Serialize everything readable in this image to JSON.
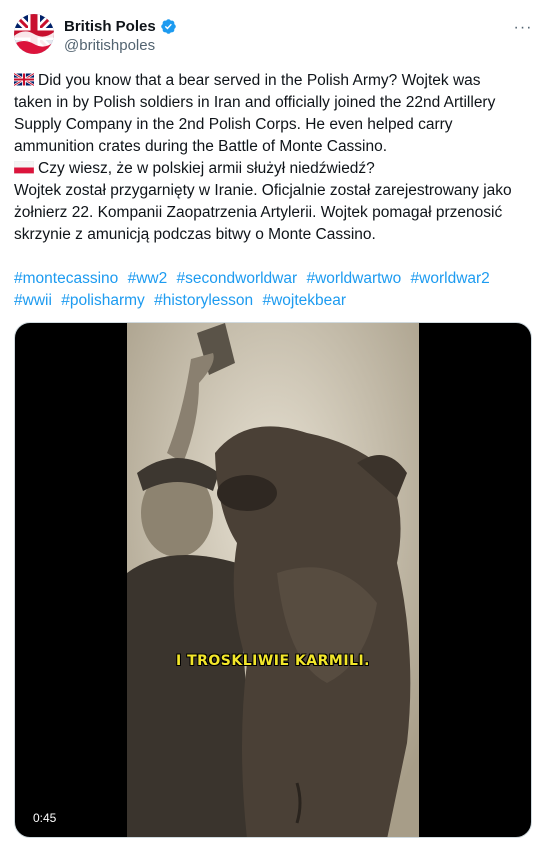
{
  "author": {
    "name": "British Poles",
    "handle": "@britishpoles"
  },
  "more_icon": "more-horizontal-icon",
  "tweet": {
    "english_lines": [
      "Did you know that a bear served in the Polish Army? Wojtek was",
      "taken in by Polish soldiers in Iran and officially joined the 22nd Artillery",
      "Supply Company in the 2nd Polish Corps. He even helped carry",
      "ammunition crates during the Battle of Monte Cassino."
    ],
    "polish_lines": [
      "Czy wiesz, że w polskiej armii służył niedźwiedź?",
      "Wojtek został przygarnięty w Iranie. Oficjalnie został zarejestrowany jako",
      "żołnierz 22. Kompanii Zaopatrzenia Artylerii. Wojtek pomagał przenosić",
      "skrzynie z amunicją podczas bitwy o Monte Cassino."
    ],
    "hashtags_line1": [
      "#montecassino",
      "#ww2",
      "#secondworldwar",
      "#worldwartwo",
      "#worldwar2"
    ],
    "hashtags_line2": [
      "#wwii",
      "#polisharmy",
      "#historylesson",
      "#wojtekbear"
    ]
  },
  "media": {
    "caption": "I TROSKLIWIE KARMILI.",
    "timestamp": "0:45"
  },
  "colors": {
    "link": "#1d9bf0",
    "verified": "#1d9bf0",
    "caption": "#f2e62a"
  }
}
